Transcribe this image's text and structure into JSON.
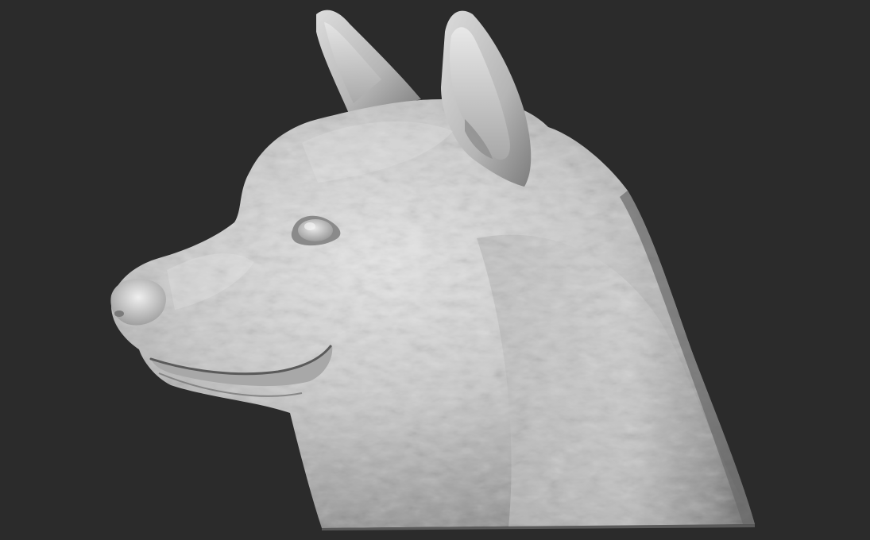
{
  "scene": {
    "subject": "dog-head-sculpt",
    "view": "left-profile",
    "colors": {
      "background": "#2b2b2b",
      "clay_light": "#e2e2e2",
      "clay_mid": "#bdbdbd",
      "clay_dark": "#7e7e7e",
      "clay_shadow": "#4a4a4a",
      "eye": "#d0d0d0",
      "nose": "#cfcfcf"
    }
  }
}
